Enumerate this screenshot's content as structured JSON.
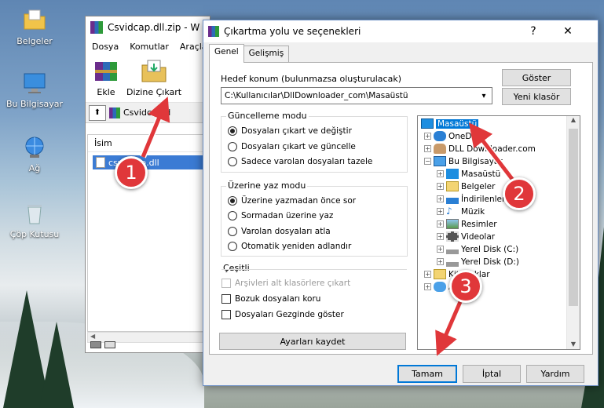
{
  "desktop": {
    "icons": [
      {
        "label": "Belgeler",
        "icon": "folder-icon"
      },
      {
        "label": "Bu Bilgisayar",
        "icon": "computer-icon"
      },
      {
        "label": "Ağ",
        "icon": "network-icon"
      },
      {
        "label": "Çöp Kutusu",
        "icon": "recycle-bin-icon"
      }
    ]
  },
  "archive_window": {
    "title": "Csvidcap.dll.zip - W",
    "menu": [
      "Dosya",
      "Komutlar",
      "Araçla"
    ],
    "toolbar": {
      "add_label": "Ekle",
      "extract_label": "Dizine Çıkart"
    },
    "path": "Csvidcap.d",
    "list_header": "İsim",
    "file_item": "csvidcap.dll"
  },
  "dialog": {
    "title": "Çıkartma yolu ve seçenekleri",
    "help_label": "?",
    "close_label": "✕",
    "tabs": [
      "Genel",
      "Gelişmiş"
    ],
    "destination_label": "Hedef konum (bulunmazsa oluşturulacak)",
    "destination_value": "C:\\Kullanıcılar\\DllDownloader_com\\Masaüstü",
    "show_button": "Göster",
    "new_folder_button": "Yeni klasör",
    "update_mode": {
      "title": "Güncelleme modu",
      "options": [
        "Dosyaları çıkart ve değiştir",
        "Dosyaları çıkart ve güncelle",
        "Sadece varolan dosyaları tazele"
      ],
      "selected": 0
    },
    "overwrite_mode": {
      "title": "Üzerine yaz modu",
      "options": [
        "Üzerine yazmadan önce sor",
        "Sormadan üzerine yaz",
        "Varolan dosyaları atla",
        "Otomatik yeniden adlandır"
      ],
      "selected": 0
    },
    "misc": {
      "title": "Çeşitli",
      "options": [
        "Arşivleri alt klasörlere çıkart",
        "Bozuk dosyaları koru",
        "Dosyaları Gezginde göster"
      ]
    },
    "save_settings_button": "Ayarları kaydet",
    "tree": [
      {
        "label": "Masaüstü",
        "level": 0,
        "icon": "desktop-icon",
        "selected": true
      },
      {
        "label": "OneDrive",
        "level": 1,
        "icon": "cloud-icon"
      },
      {
        "label": "DLL Downloader.com",
        "level": 1,
        "icon": "user-icon"
      },
      {
        "label": "Bu Bilgisayar",
        "level": 1,
        "icon": "computer-icon"
      },
      {
        "label": "Masaüstü",
        "level": 2,
        "icon": "desktop-icon"
      },
      {
        "label": "Belgeler",
        "level": 2,
        "icon": "documents-icon"
      },
      {
        "label": "İndirilenler",
        "level": 2,
        "icon": "download-icon"
      },
      {
        "label": "Müzik",
        "level": 2,
        "icon": "music-icon"
      },
      {
        "label": "Resimler",
        "level": 2,
        "icon": "pictures-icon"
      },
      {
        "label": "Videolar",
        "level": 2,
        "icon": "video-icon"
      },
      {
        "label": "Yerel Disk (C:)",
        "level": 2,
        "icon": "drive-icon"
      },
      {
        "label": "Yerel Disk (D:)",
        "level": 2,
        "icon": "drive-icon"
      },
      {
        "label": "Kitaplıklar",
        "level": 1,
        "icon": "libraries-icon"
      },
      {
        "label": "Ağ",
        "level": 1,
        "icon": "network-icon"
      }
    ],
    "ok_button": "Tamam",
    "cancel_button": "İptal",
    "help_button": "Yardım"
  },
  "markers": [
    "1",
    "2",
    "3"
  ],
  "colors": {
    "marker": "#e0373a",
    "selection": "#0078d7",
    "accent": "#3b7bd4"
  }
}
